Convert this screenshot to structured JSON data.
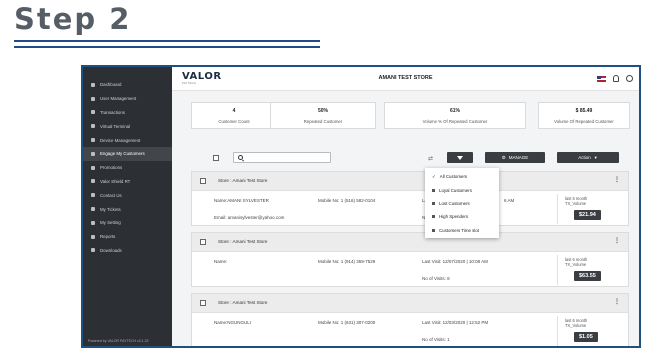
{
  "heading": {
    "title": "Step 2"
  },
  "sidebar": {
    "items": [
      {
        "label": "Dashboard",
        "icon": "dashboard-icon"
      },
      {
        "label": "User Management",
        "icon": "users-icon"
      },
      {
        "label": "Transactions",
        "icon": "transactions-icon"
      },
      {
        "label": "Virtual Terminal",
        "icon": "terminal-icon"
      },
      {
        "label": "Device Management",
        "icon": "device-icon"
      },
      {
        "label": "Engage My Customers",
        "icon": "engage-icon"
      },
      {
        "label": "Promotions",
        "icon": "promotions-icon"
      },
      {
        "label": "Valor Shield RT",
        "icon": "shield-icon"
      },
      {
        "label": "Contact Us",
        "icon": "contact-icon"
      },
      {
        "label": "My Tickets",
        "icon": "tickets-icon"
      },
      {
        "label": "My Setting",
        "icon": "settings-icon"
      },
      {
        "label": "Reports",
        "icon": "reports-icon"
      },
      {
        "label": "Downloads",
        "icon": "downloads-icon"
      }
    ],
    "active": "Engage My Customers",
    "powered": "Powered by VALOR PAYTECH v3.1.23"
  },
  "topbar": {
    "logo": "VALOR",
    "logo_sub": "PAYTECH",
    "store_title": "AMANI TEST STORE"
  },
  "stats": [
    {
      "value": "4",
      "label": "Customer Count"
    },
    {
      "value": "50%",
      "label": "Repeated Customer"
    },
    {
      "value": "61%",
      "label": "Volume % Of Repeated Customer"
    },
    {
      "value": "$ 85.49",
      "label": "Volume Of Repeated Customer"
    }
  ],
  "toolbar": {
    "search_placeholder": "",
    "manage_label": "MANAGE",
    "action_label": "Action"
  },
  "filter_menu": {
    "items": [
      "All Customers",
      "Loyal Customers",
      "Lost Customers",
      "High Spenders",
      "Customers Time slot"
    ]
  },
  "cards": [
    {
      "store": "Store : Amani Test Store",
      "name": "Name:AMANI SYLVESTER",
      "mobile": "Mobile No: 1 (516) 582-0104",
      "last_visit": "Last Visit:",
      "time": "6 AM",
      "email": "Email: amanisylvester@yahoo.com",
      "visits": "No",
      "vol_label1": "last 6 month",
      "vol_label2": "TX_Volume",
      "vol_value": "$21.94"
    },
    {
      "store": "Store : Amani Test Store",
      "name": "Name:",
      "mobile": "Mobile No: 1 (914) 359-7529",
      "last_visit": "Last Visit: 12/07/2020 | 10:08 AM",
      "visits": "No of Visits: 8",
      "vol_label1": "last 6 month",
      "vol_label2": "TX_Volume",
      "vol_value": "$63.55"
    },
    {
      "store": "Store : Amani Test Store",
      "name": "Name:NGUNGULI",
      "mobile": "Mobile No: 1 (631) 307-0200",
      "last_visit": "Last Visit: 12/03/2020 | 12:52 PM",
      "visits": "No of Visits: 1",
      "vol_label1": "last 6 month",
      "vol_label2": "TX_Volume",
      "vol_value": "$1.05"
    }
  ]
}
